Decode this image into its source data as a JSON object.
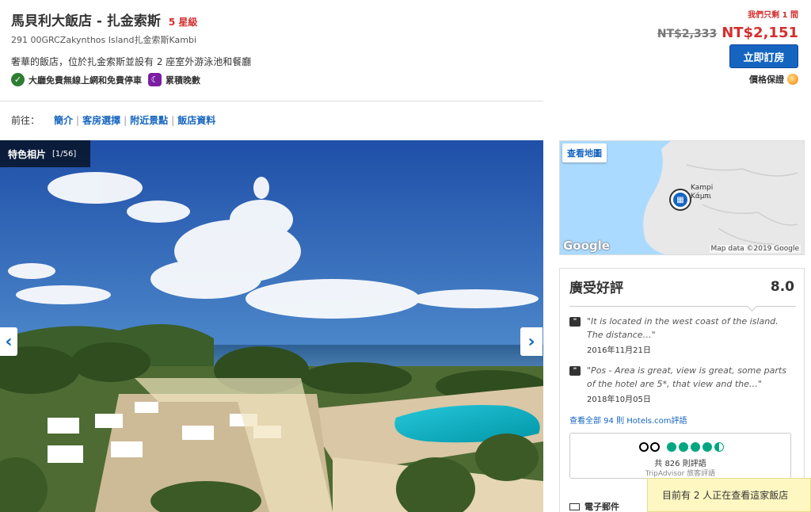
{
  "hotel": {
    "name": "馬貝利大飯店 - 扎金索斯",
    "star_rating": "5 星級",
    "address": "291 00GRCZakynthos Island扎金索斯Kambi",
    "description": "奢華的飯店，位於扎金索斯並設有 2 座室外游泳池和餐廳",
    "amenities": [
      {
        "icon": "check-circle-icon",
        "label": "大廳免費無線上網和免費停車"
      },
      {
        "icon": "moon-icon",
        "label": "累積晚數"
      }
    ]
  },
  "pricing": {
    "rooms_left": "我們只剩 1 間",
    "old_price": "NT$2,333",
    "new_price": "NT$2,151",
    "book_label": "立即訂房",
    "guarantee_label": "價格保證"
  },
  "nav": {
    "prefix": "前往：",
    "links": [
      "簡介",
      "客房選擇",
      "附近景點",
      "飯店資料"
    ]
  },
  "gallery": {
    "label": "特色相片",
    "count": "[1/56]"
  },
  "map": {
    "button": "查看地圖",
    "place_latin": "Kampi",
    "place_greek": "Κάμπι",
    "logo": "Google",
    "copyright": "Map data ©2019 Google"
  },
  "reviews": {
    "title": "廣受好評",
    "score": "8.0",
    "items": [
      {
        "quote": "\"It is located in the west coast of the island. The distance…\"",
        "date": "2016年11月21日"
      },
      {
        "quote": "\"Pos - Area is great, view is great, some parts of the hotel are 5*, that view and the…\"",
        "date": "2018年10月05日"
      }
    ],
    "all_link": "查看全部 94 則 Hotels.com評語",
    "tripadvisor": {
      "rating": 4.5,
      "count": "共 826 則評語",
      "brand": "TripAdvisor 旅客評語"
    },
    "email_label": "電子郵件"
  },
  "toast": {
    "text": "目前有 2 人正在查看這家飯店"
  },
  "colors": {
    "accent": "#1565c0",
    "price_red": "#d32f2f",
    "tripadvisor_green": "#00a680"
  }
}
